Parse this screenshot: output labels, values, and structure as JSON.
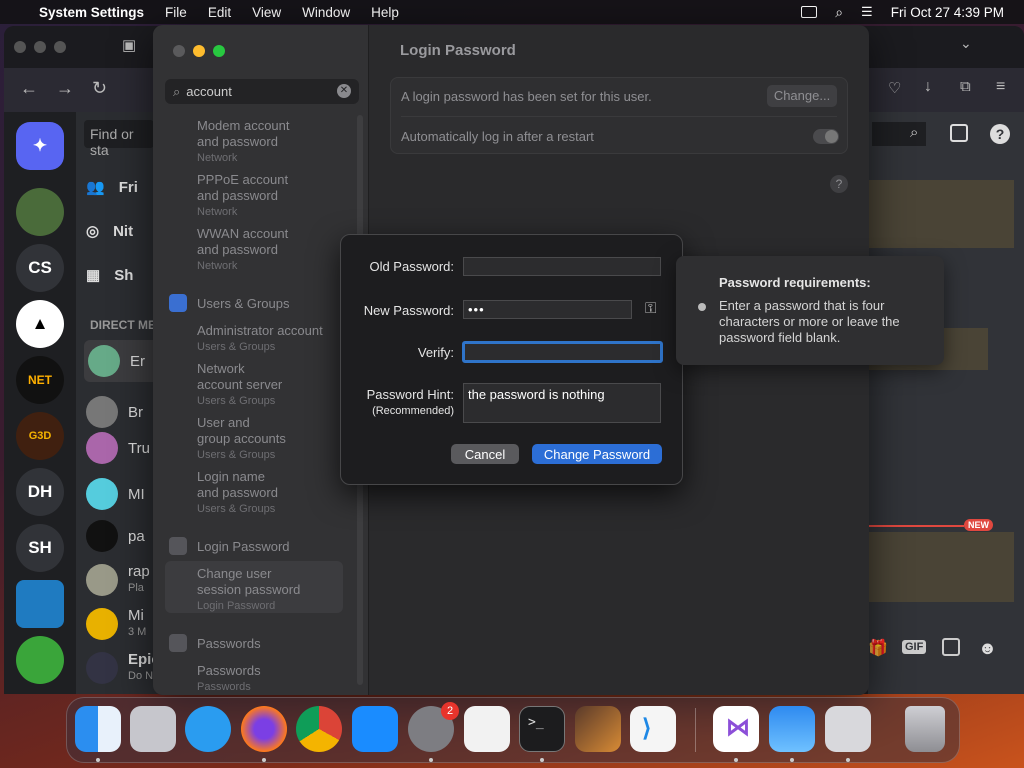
{
  "menubar": {
    "app": "System Settings",
    "items": [
      "File",
      "Edit",
      "View",
      "Window",
      "Help"
    ],
    "datetime": "Fri Oct 27  4:39 PM"
  },
  "discord": {
    "servers": [
      "CS",
      "DH",
      "SH"
    ],
    "find_placeholder": "Find or sta",
    "nav": [
      "Fri",
      "Nit",
      "Sh"
    ],
    "direct_messages": "DIRECT ME",
    "dms": [
      {
        "name": "Er"
      },
      {
        "name": "Br"
      },
      {
        "name": "Tru"
      },
      {
        "name": "MI"
      },
      {
        "name": "pa"
      },
      {
        "name": "rap",
        "sub": "Pla"
      },
      {
        "name": "Mi",
        "sub": "3 M"
      },
      {
        "name": "Epicr",
        "sub": "Do No"
      }
    ],
    "new_badge": "NEW",
    "gif": "GIF"
  },
  "settings": {
    "search_value": "account",
    "results": [
      {
        "line1": "Modem account",
        "line2": "and password",
        "sub": "Network"
      },
      {
        "line1": "PPPoE account",
        "line2": "and password",
        "sub": "Network"
      },
      {
        "line1": "WWAN account",
        "line2": "and password",
        "sub": "Network"
      }
    ],
    "users_groups_header": "Users & Groups",
    "ug_results": [
      {
        "line1": "Administrator account",
        "line2": "",
        "sub": "Users & Groups"
      },
      {
        "line1": "Network",
        "line2": "account server",
        "sub": "Users & Groups"
      },
      {
        "line1": "User and",
        "line2": "group accounts",
        "sub": "Users & Groups"
      },
      {
        "line1": "Login name",
        "line2": "and password",
        "sub": "Users & Groups"
      }
    ],
    "login_header": "Login Password",
    "login_result": {
      "line1": "Change user",
      "line2": "session password",
      "sub": "Login Password"
    },
    "passwords_header": "Passwords",
    "passwords_result": {
      "line1": "Passwords",
      "sub": "Passwords"
    },
    "page_title": "Login Password",
    "row1_text": "A login password has been set for this user.",
    "change_btn": "Change...",
    "row2_text": "Automatically log in after a restart",
    "help": "?"
  },
  "dialog": {
    "old_label": "Old Password:",
    "new_label": "New Password:",
    "new_value": "•••",
    "verify_label": "Verify:",
    "hint_label": "Password Hint:",
    "hint_sub": "(Recommended)",
    "hint_value": "the password is nothing",
    "cancel": "Cancel",
    "change": "Change Password"
  },
  "popover": {
    "title": "Password requirements:",
    "text": "Enter a password that is four characters or more or leave the password field blank."
  },
  "dock": {
    "badge": "2"
  }
}
